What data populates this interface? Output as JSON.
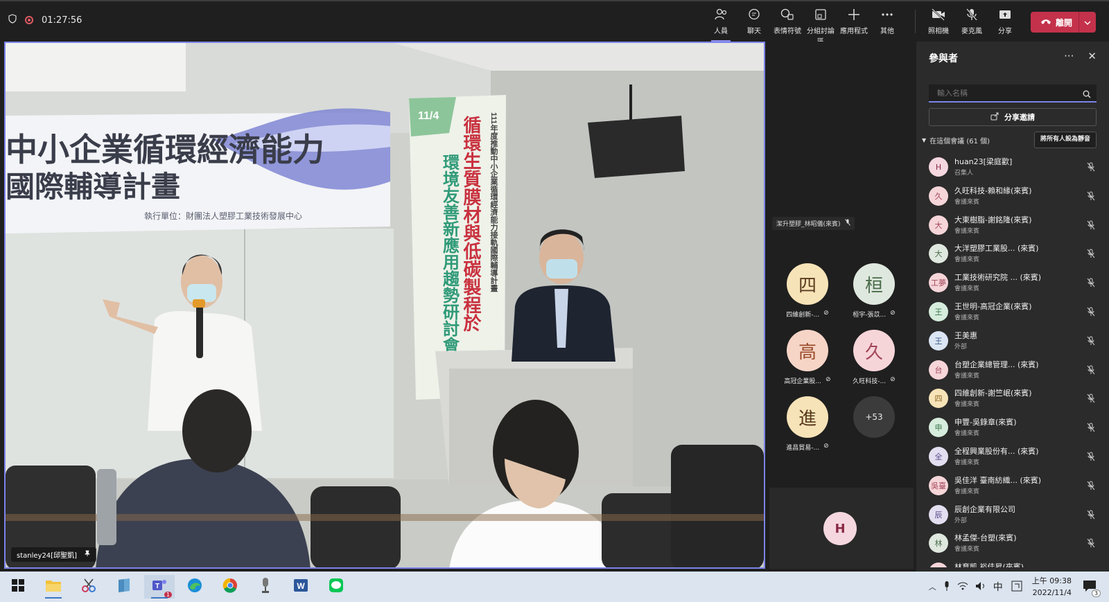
{
  "meeting": {
    "timer": "01:27:56"
  },
  "toolbar": {
    "items": [
      {
        "label": "人員",
        "icon": "people-icon"
      },
      {
        "label": "聊天",
        "icon": "chat-icon"
      },
      {
        "label": "表情符號",
        "icon": "reactions-icon"
      },
      {
        "label": "分組討論區",
        "icon": "breakout-rooms-icon"
      },
      {
        "label": "應用程式",
        "icon": "add-app-icon"
      },
      {
        "label": "其他",
        "icon": "more-icon"
      },
      {
        "label": "照相機",
        "icon": "camera-off-icon"
      },
      {
        "label": "麥克風",
        "icon": "mic-off-icon"
      },
      {
        "label": "分享",
        "icon": "share-tray-icon"
      }
    ],
    "leave_label": "離開",
    "leave_color": "#c4314b"
  },
  "stage": {
    "speaker_name": "stanley24[邱聖凱]",
    "banner_line1": "中小企業循環經濟能力",
    "banner_line2": "國際輔導計畫",
    "banner_footer": "執行單位：財團法人塑膠工業技術發展中心",
    "standee_date": "11/4",
    "standee_text1": "循環生質膜材與低碳製程於",
    "standee_text2": "環境友善新應用趨勢研討會",
    "standee_text3": "111年度推動中小企業循環經濟能力接軌國際輔導計畫"
  },
  "gallery": {
    "active_label": "潔升塑膠_林昭儀(來賓)",
    "tiles": [
      {
        "char": "四",
        "name": "四維創新-...",
        "color": "#f7e3b8"
      },
      {
        "char": "桓",
        "name": "桓宇-張苡...",
        "color": "#dfe8df"
      },
      {
        "char": "高",
        "name": "高冠企業股...",
        "color": "#f6d5c7"
      },
      {
        "char": "久",
        "name": "久旺科技-...",
        "color": "#f6d5d9"
      },
      {
        "char": "進",
        "name": "進昌貿易-...",
        "color": "#f7e3b8"
      }
    ],
    "overflow": "+53",
    "self_initial": "H"
  },
  "panel": {
    "title": "參與者",
    "search_placeholder": "輸入名稱",
    "share_invite": "分享邀請",
    "section": "在這個會議 (61 個)",
    "mute_all": "將所有人設為靜音",
    "participants": [
      {
        "initial": "H",
        "name": "huan23[梁庭歡]",
        "role": "召集人",
        "color": "#f5d7e0",
        "fg": "#8a2a45"
      },
      {
        "initial": "久",
        "name": "久旺科技-賴和緣(來賓)",
        "role": "會議來賓",
        "color": "#f6d5d9",
        "fg": "#a3485a"
      },
      {
        "initial": "大",
        "name": "大東樹脂-謝銘隆(來賓)",
        "role": "會議來賓",
        "color": "#f6d5d9",
        "fg": "#a3485a"
      },
      {
        "initial": "大",
        "name": "大洋塑膠工業股... (來賓)",
        "role": "會議來賓",
        "color": "#dfe8df",
        "fg": "#4a6b4a"
      },
      {
        "initial": "工夢",
        "name": "工業技術研究院 ... (來賓)",
        "role": "會議來賓",
        "color": "#f6d5d9",
        "fg": "#a3485a"
      },
      {
        "initial": "王",
        "name": "王世明-高冠企業(來賓)",
        "role": "會議來賓",
        "color": "#d6ecdc",
        "fg": "#3e7a4e"
      },
      {
        "initial": "王",
        "name": "王美惠",
        "role": "外部",
        "color": "#dbe5f3",
        "fg": "#3c5c8a"
      },
      {
        "initial": "台",
        "name": "台塑企業總管理... (來賓)",
        "role": "會議來賓",
        "color": "#f6d5d9",
        "fg": "#a3485a"
      },
      {
        "initial": "四",
        "name": "四維創新-謝竺岷(來賓)",
        "role": "會議來賓",
        "color": "#f7e3b8",
        "fg": "#8a6420"
      },
      {
        "initial": "申",
        "name": "申豐-吳錄章(來賓)",
        "role": "會議來賓",
        "color": "#d6ecdc",
        "fg": "#3e7a4e"
      },
      {
        "initial": "全",
        "name": "全程興業股份有... (來賓)",
        "role": "會議來賓",
        "color": "#e3def0",
        "fg": "#5a4a8a"
      },
      {
        "initial": "吳臺",
        "name": "吳佳洋 臺南紡織... (來賓)",
        "role": "會議來賓",
        "color": "#f6d5d9",
        "fg": "#a3485a"
      },
      {
        "initial": "辰",
        "name": "辰創企業有限公司",
        "role": "外部",
        "color": "#e3def0",
        "fg": "#5a4a8a"
      },
      {
        "initial": "林",
        "name": "林孟傑-台塑(來賓)",
        "role": "會議來賓",
        "color": "#dfe8df",
        "fg": "#4a6b4a"
      },
      {
        "initial": "林裕",
        "name": "林育凱 裕佳昇(來賓)",
        "role": "",
        "color": "#f6d5d9",
        "fg": "#a3485a"
      }
    ]
  },
  "taskbar": {
    "apps": [
      {
        "name": "file-explorer-icon"
      },
      {
        "name": "snipping-tool-icon"
      },
      {
        "name": "notes-app-icon"
      },
      {
        "name": "teams-icon",
        "badge": "1"
      },
      {
        "name": "edge-icon"
      },
      {
        "name": "chrome-icon"
      },
      {
        "name": "microphone-app-icon"
      },
      {
        "name": "word-icon"
      },
      {
        "name": "line-icon"
      }
    ],
    "ime": "中",
    "time": "上午 09:38",
    "date": "2022/11/4",
    "notifications": "3"
  }
}
